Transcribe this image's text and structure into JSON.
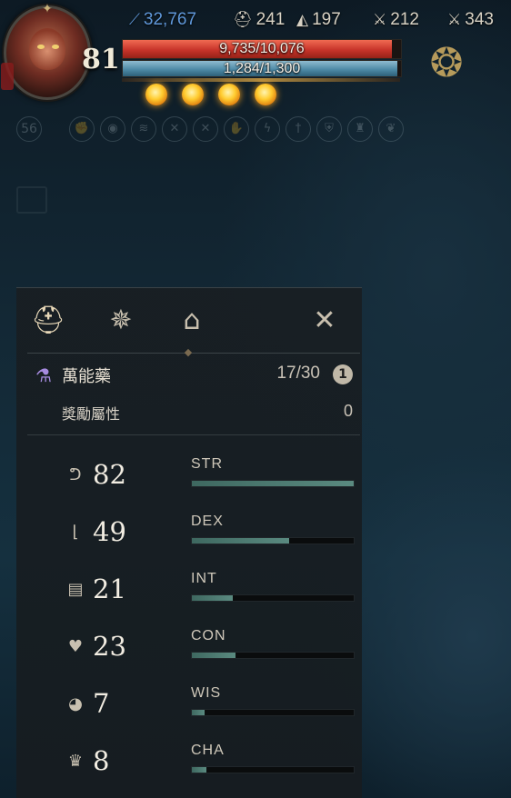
{
  "hud": {
    "level": "81",
    "currency": "32,767",
    "armor": "241",
    "stat_a": "197",
    "stat_b": "212",
    "stat_c": "343",
    "hp_text": "9,735/10,076",
    "hp_fraction": 0.966,
    "mp_text": "1,284/1,300",
    "mp_fraction": 0.988,
    "orbs": 4,
    "buff_count": "56",
    "colors": {
      "hp": "#c7342a",
      "mp": "#4e8aa6",
      "orb": "#ffcc30",
      "currency": "#5f97d9"
    },
    "icons": [
      "feather-icon",
      "helmet-icon",
      "hat-icon",
      "sword-icon",
      "dual-swords-icon"
    ]
  },
  "tabs": [
    {
      "name": "character",
      "icon": "helmet-icon",
      "active": true
    },
    {
      "name": "skills",
      "icon": "compass-star-icon",
      "active": false
    },
    {
      "name": "housing",
      "icon": "house-icon",
      "active": false
    }
  ],
  "potion": {
    "label": "萬能藥",
    "count": "17/30",
    "info": "1"
  },
  "bonus": {
    "label": "獎勵屬性",
    "value": "0"
  },
  "attributes": [
    {
      "name": "STR",
      "value": "82",
      "fraction": 1.0,
      "icon": "muscle-arm-icon"
    },
    {
      "name": "DEX",
      "value": "49",
      "fraction": 0.6,
      "icon": "boot-icon"
    },
    {
      "name": "INT",
      "value": "21",
      "fraction": 0.25,
      "icon": "book-icon"
    },
    {
      "name": "CON",
      "value": "23",
      "fraction": 0.27,
      "icon": "heart-beat-icon"
    },
    {
      "name": "WIS",
      "value": "7",
      "fraction": 0.08,
      "icon": "mind-head-icon"
    },
    {
      "name": "CHA",
      "value": "8",
      "fraction": 0.09,
      "icon": "crown-icon"
    }
  ]
}
